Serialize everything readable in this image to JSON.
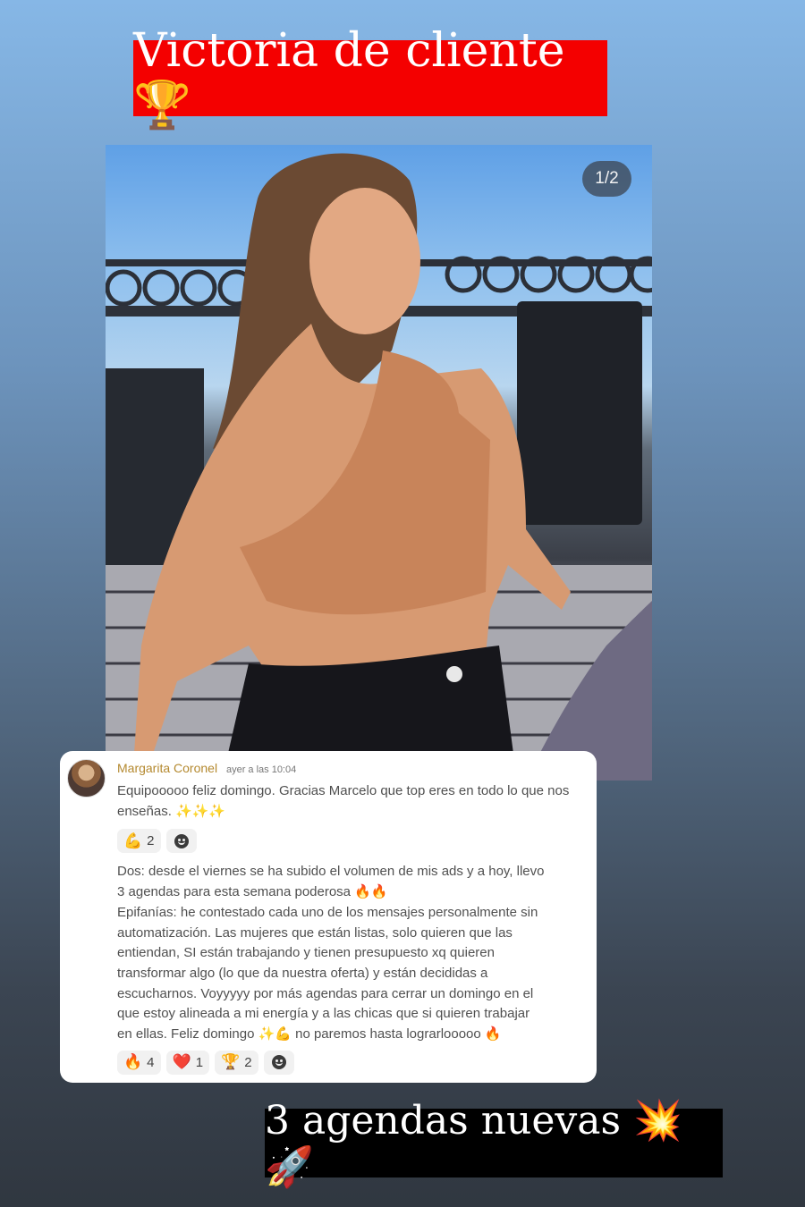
{
  "header": {
    "title": "Victoria de cliente 🏆"
  },
  "photo": {
    "page_counter": "1/2"
  },
  "comment": {
    "author": "Margarita Coronel",
    "time": "ayer a las 10:04",
    "message1": "Equipooooo feliz domingo. Gracias Marcelo que top eres en todo lo que nos enseñas. ✨✨✨",
    "reactions1": [
      {
        "emoji": "💪",
        "count": "2"
      }
    ],
    "message2_lines": [
      "Dos: desde el viernes se ha subido el volumen de mis ads y a hoy, llevo",
      "3 agendas para esta semana poderosa 🔥🔥",
      "Epifanías: he contestado cada uno de los mensajes personalmente sin",
      "automatización. Las mujeres que están listas, solo quieren que las",
      "entiendan, SI están trabajando y tienen presupuesto xq quieren",
      "transformar algo (lo que da nuestra oferta) y están decididas a",
      "escucharnos. Voyyyyy por más agendas para cerrar un domingo en el",
      "que estoy alineada a mi energía y a las chicas que si quieren trabajar",
      "en ellas. Feliz domingo ✨💪 no paremos hasta lograrlooooo 🔥"
    ],
    "reactions2": [
      {
        "emoji": "🔥",
        "count": "4"
      },
      {
        "emoji": "❤️",
        "count": "1"
      },
      {
        "emoji": "🏆",
        "count": "2"
      }
    ]
  },
  "footer": {
    "caption": "3 agendas nuevas 💥🚀"
  }
}
